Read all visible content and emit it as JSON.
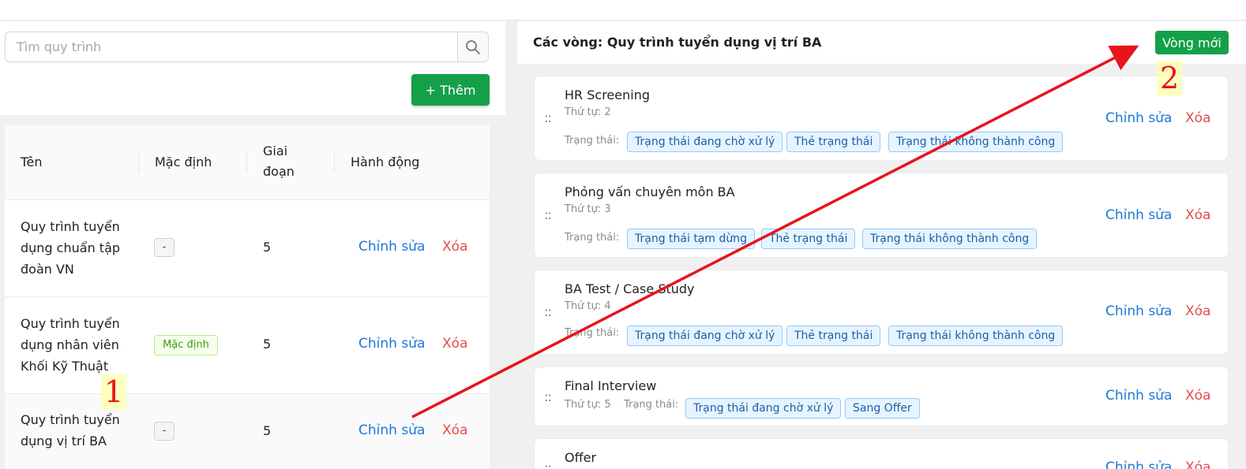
{
  "left": {
    "search_placeholder": "Tìm quy trình",
    "add_label": "+ Thêm",
    "columns": {
      "name": "Tên",
      "default": "Mặc định",
      "stage_line1": "Giai",
      "stage_line2": "đoạn",
      "action": "Hành động"
    },
    "rows": [
      {
        "name_lines": [
          "Quy trình tuyển",
          "dụng chuẩn tập",
          "đoàn VN"
        ],
        "default": "-",
        "stages": "5",
        "edit": "Chỉnh sửa",
        "delete": "Xóa"
      },
      {
        "name_lines": [
          "Quy trình tuyển",
          "dụng nhân viên",
          "Khối Kỹ Thuật"
        ],
        "default": "Mặc định",
        "stages": "5",
        "edit": "Chỉnh sửa",
        "delete": "Xóa"
      },
      {
        "name_lines": [
          "Quy trình tuyển",
          "dụng vị trí BA"
        ],
        "default": "-",
        "stages": "5",
        "edit": "Chỉnh sửa",
        "delete": "Xóa"
      }
    ]
  },
  "right": {
    "title": "Các vòng: Quy trình tuyển dụng vị trí BA",
    "new_round_label": "Vòng mới",
    "status_label": "Trạng thái:",
    "edit_label": "Chỉnh sửa",
    "delete_label": "Xóa",
    "rounds": [
      {
        "name": "HR Screening",
        "order": "Thứ tự: 2",
        "statuses": [
          "Trạng thái đang chờ xử lý",
          "Thẻ trạng thái",
          "Trạng thái không thành công"
        ]
      },
      {
        "name": "Phỏng vấn chuyên môn BA",
        "order": "Thứ tự: 3",
        "statuses": [
          "Trạng thái tạm dừng",
          "Thẻ trạng thái",
          "Trạng thái không thành công"
        ]
      },
      {
        "name": "BA Test / Case Study",
        "order": "Thứ tự: 4",
        "statuses": [
          "Trạng thái đang chờ xử lý",
          "Thẻ trạng thái",
          "Trạng thái không thành công"
        ]
      },
      {
        "name": "Final Interview",
        "order": "Thứ tự: 5",
        "statuses": [
          "Trạng thái đang chờ xử lý",
          "Sang Offer"
        ]
      },
      {
        "name": "Offer",
        "order": "",
        "statuses": []
      }
    ]
  },
  "annotations": {
    "step1": "1",
    "step2": "2",
    "color": "#e8141c"
  },
  "icons": {
    "search": "search-icon",
    "drag": "drag-handle-icon"
  }
}
